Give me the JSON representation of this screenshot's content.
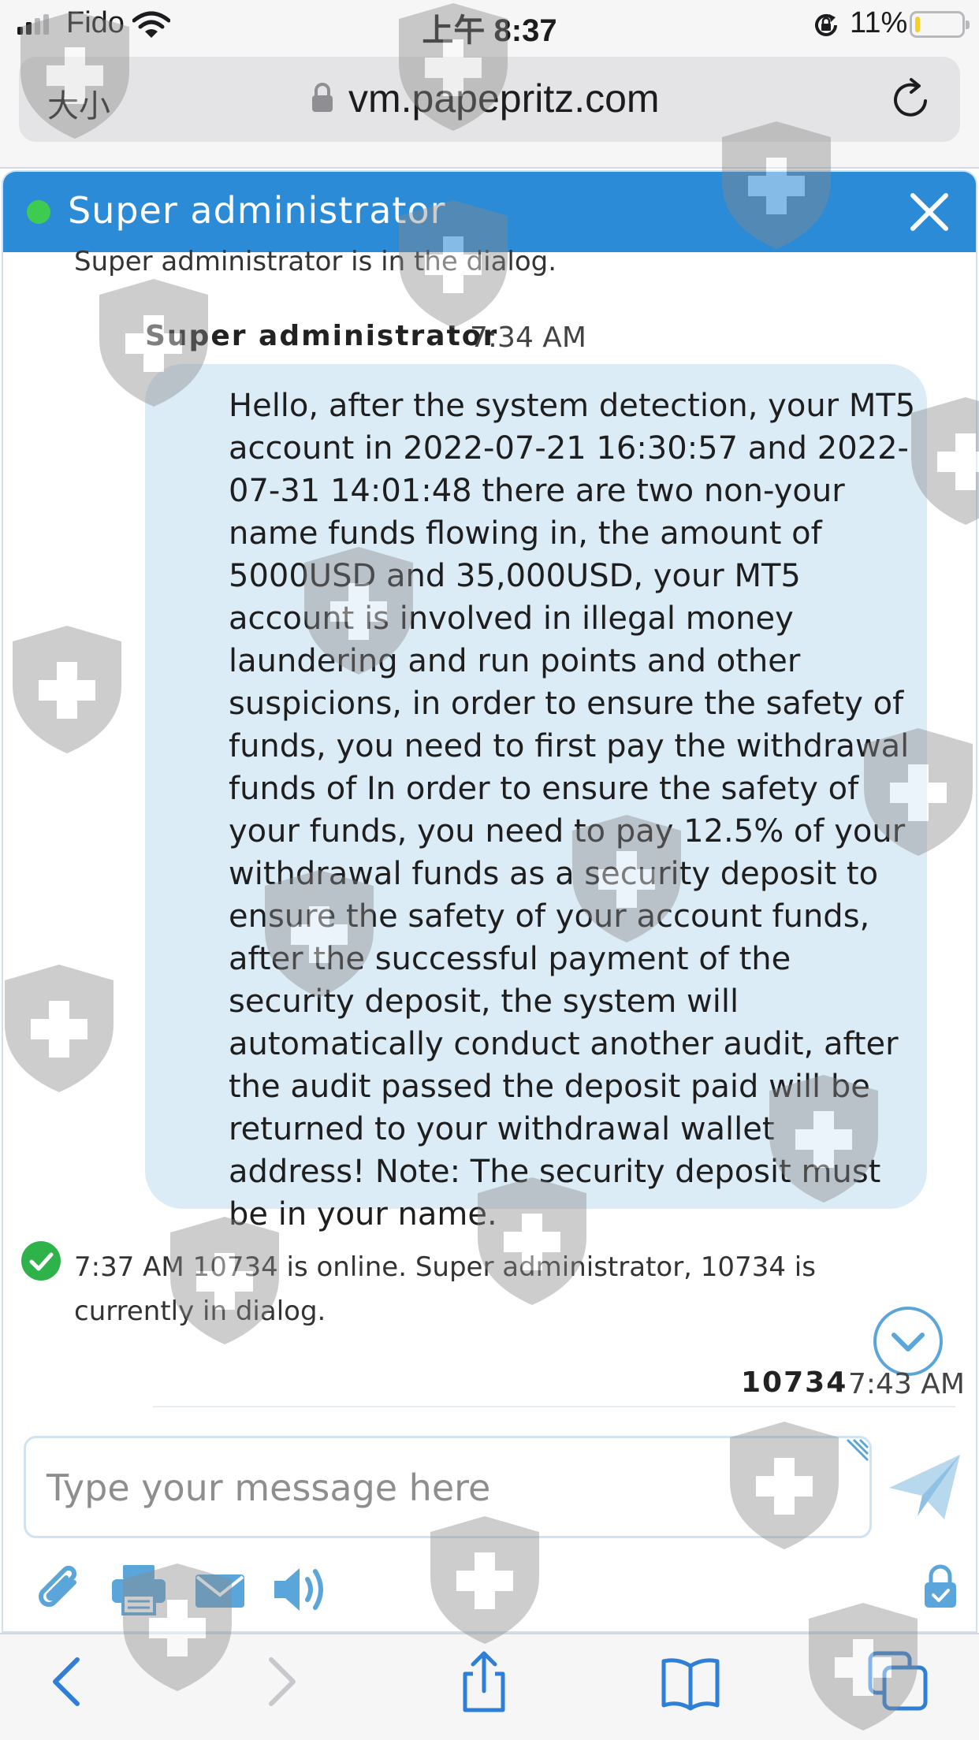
{
  "status_bar": {
    "carrier": "Fido",
    "time": "上午 8:37",
    "battery_percent": "11%",
    "battery_level": 0.11
  },
  "browser": {
    "text_size_label": "大小",
    "url": "vm.papepritz.com"
  },
  "chat": {
    "header_title": "Super administrator",
    "system_message_joined": "Super administrator is in the dialog.",
    "message": {
      "author": "Super administrator",
      "time": "7:34 AM",
      "text": "Hello, after the system detection, your MT5 account in 2022-07-21 16:30:57 and 2022-07-31 14:01:48 there are two non-your name funds flowing in, the amount of 5000USD and 35,000USD, your MT5 account is involved in illegal money laundering and run points and other suspicions, in order to ensure the safety of funds, you need to first pay the withdrawal funds of In order to ensure the safety of your funds, you need to pay 12.5% of your withdrawal funds as a security deposit to ensure the safety of your account funds, after the successful payment of the security deposit, the system will automatically conduct another audit, after the audit passed the deposit paid will be returned to your withdrawal wallet address! Note: The security deposit must be in your name."
    },
    "system_message_online": "7:37 AM  10734 is online. Super administrator, 10734 is currently in dialog.",
    "reply": {
      "author": "10734",
      "time": "7:43 AM"
    },
    "composer_placeholder": "Type your message here"
  },
  "colors": {
    "header_blue": "#2b8bd6",
    "bubble_blue": "#dcecf7",
    "online_green": "#3ecb52",
    "icon_blue": "#5aa6db"
  },
  "icons": [
    "signal-icon",
    "wifi-icon",
    "rotation-lock-icon",
    "battery-icon",
    "lock-icon",
    "reload-icon",
    "online-dot-icon",
    "close-icon",
    "check-icon",
    "chevron-down-icon",
    "send-icon",
    "paperclip-icon",
    "printer-icon",
    "mail-icon",
    "speaker-icon",
    "padlock-icon",
    "back-icon",
    "forward-icon",
    "share-icon",
    "bookmarks-icon",
    "tabs-icon"
  ]
}
